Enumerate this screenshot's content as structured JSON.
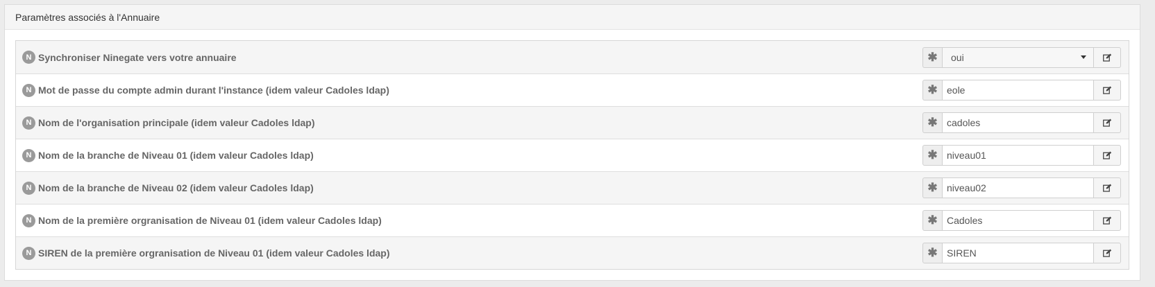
{
  "panel": {
    "title": "Paramètres associés à l'Annuaire"
  },
  "badge_letter": "N",
  "addon_symbol": "✱",
  "rows": [
    {
      "label": "Synchroniser Ninegate vers votre annuaire",
      "type": "select",
      "value": "oui"
    },
    {
      "label": "Mot de passe du compte admin durant l'instance (idem valeur Cadoles ldap)",
      "type": "input",
      "value": "eole"
    },
    {
      "label": "Nom de l'organisation principale (idem valeur Cadoles ldap)",
      "type": "input",
      "value": "cadoles"
    },
    {
      "label": "Nom de la branche de Niveau 01 (idem valeur Cadoles ldap)",
      "type": "input",
      "value": "niveau01"
    },
    {
      "label": "Nom de la branche de Niveau 02 (idem valeur Cadoles ldap)",
      "type": "input",
      "value": "niveau02"
    },
    {
      "label": "Nom de la première orgranisation de Niveau 01 (idem valeur Cadoles ldap)",
      "type": "input",
      "value": "Cadoles"
    },
    {
      "label": "SIREN de la première orgranisation de Niveau 01 (idem valeur Cadoles ldap)",
      "type": "input",
      "value": "SIREN"
    }
  ],
  "icons": {
    "badge": "n-badge-icon",
    "addon": "asterisk-icon",
    "edit": "edit-icon",
    "dropdown": "caret-down-icon"
  }
}
